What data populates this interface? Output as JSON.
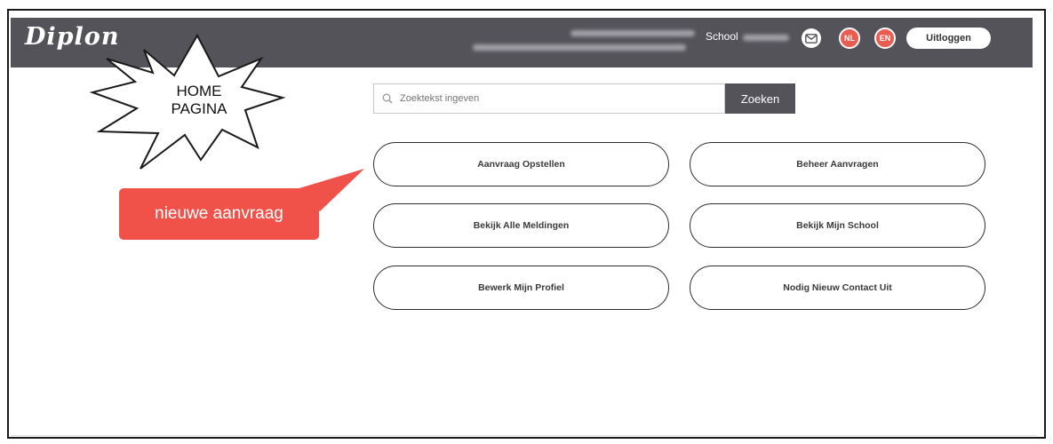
{
  "header": {
    "logo": "Diplon",
    "school_label": "School",
    "mail_icon": "mail-icon",
    "languages": [
      "NL",
      "EN"
    ],
    "logout_label": "Uitloggen"
  },
  "search": {
    "placeholder": "Zoektekst ingeven",
    "button_label": "Zoeken",
    "icon": "search-icon"
  },
  "menu": {
    "buttons": [
      {
        "label": "Aanvraag Opstellen"
      },
      {
        "label": "Beheer Aanvragen"
      },
      {
        "label": "Bekijk Alle Meldingen"
      },
      {
        "label": "Bekijk Mijn School"
      },
      {
        "label": "Bewerk Mijn Profiel"
      },
      {
        "label": "Nodig Nieuw Contact Uit"
      }
    ]
  },
  "annotations": {
    "starburst_text": "HOME PAGINA",
    "callout_text": "nieuwe aanvraag"
  },
  "colors": {
    "header_bg": "#54535a",
    "lang_accent": "#e85d4f",
    "callout_bg": "#f0524a"
  }
}
